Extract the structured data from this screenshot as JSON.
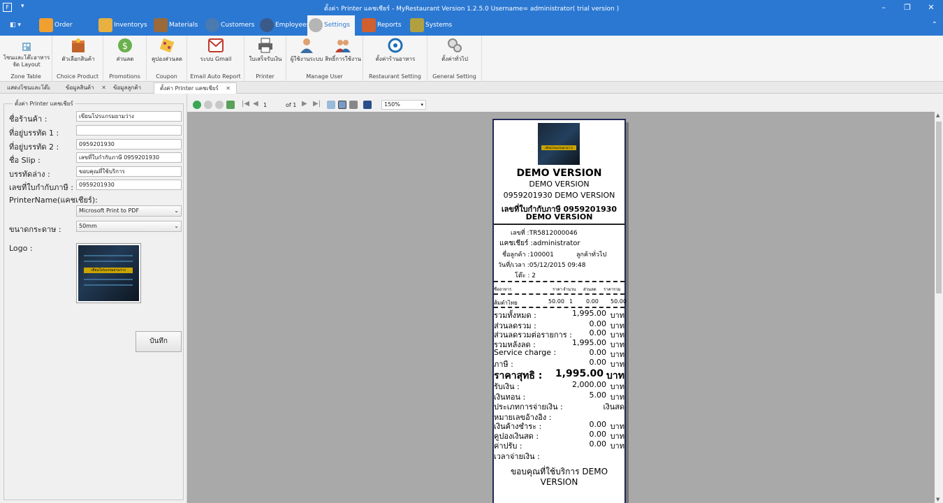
{
  "titlebar": {
    "title": "ตั้งค่า Printer แคชเชียร์ - MyRestaurant Version 1.2.5.0 Username= administrator( trial version )",
    "app_icon": "F",
    "quick_access": "▾",
    "minimize": "–",
    "restore": "❐",
    "close": "✕"
  },
  "menu": {
    "tabs": [
      {
        "label": "Order Foods",
        "icon": "checklist-icon",
        "color": "#f0a030"
      },
      {
        "label": "Inventorys",
        "icon": "box-icon",
        "color": "#e8b040"
      },
      {
        "label": "Materials",
        "icon": "books-icon",
        "color": "#9a6a3a"
      },
      {
        "label": "Customers",
        "icon": "user-icon",
        "color": "#4a7ab0"
      },
      {
        "label": "Employees",
        "icon": "employee-icon",
        "color": "#3a5a8a"
      },
      {
        "label": "Settings",
        "icon": "gears-icon",
        "color": "#909090"
      },
      {
        "label": "Reports",
        "icon": "report-icon",
        "color": "#d06030"
      },
      {
        "label": "Systems",
        "icon": "lock-icon",
        "color": "#b0a040"
      }
    ],
    "collapse": "⌃"
  },
  "ribbon": {
    "groups": [
      {
        "label": "Zone Table",
        "buttons": [
          {
            "label": "โซนและโต๊ะอาหาร จัด Layout"
          }
        ]
      },
      {
        "label": "Choice Product",
        "buttons": [
          {
            "label": "ตัวเลือกสินค้า"
          }
        ]
      },
      {
        "label": "Promotions",
        "buttons": [
          {
            "label": "ส่วนลด"
          }
        ]
      },
      {
        "label": "Coupon",
        "buttons": [
          {
            "label": "คูปองส่วนลด"
          }
        ]
      },
      {
        "label": "Email Auto Report",
        "buttons": [
          {
            "label": "ระบบ Gmail"
          }
        ]
      },
      {
        "label": "Printer",
        "buttons": [
          {
            "label": "ใบเสร็จรับเงิน"
          }
        ]
      },
      {
        "label": "Manage User",
        "buttons": [
          {
            "label": "ผู้ใช้งานระบบ"
          },
          {
            "label": "สิทธิ์การใช้งาน"
          }
        ]
      },
      {
        "label": "Restaurant Setting",
        "buttons": [
          {
            "label": "ตั้งค่าร้านอาหาร"
          }
        ]
      },
      {
        "label": "General Setting",
        "buttons": [
          {
            "label": "ตั้งค่าทั่วไป"
          }
        ]
      }
    ]
  },
  "doctabs": [
    {
      "label": "แสดงโซนและโต๊ะ",
      "closable": false
    },
    {
      "label": "ข้อมูลสินค้า",
      "closable": true
    },
    {
      "label": "ข้อมูลลูกค้า",
      "closable": false
    },
    {
      "label": "ตั้งค่า Printer แคชเชียร์",
      "closable": true
    }
  ],
  "tab_close": "✕",
  "form": {
    "group_title": "ตั้งค่า Printer แคชเชียร์",
    "shop_name_label": "ชื่อร้านค้า :",
    "shop_name": "เขียนโปรแกรมยามว่าง",
    "address1_label": "ที่อยู่บรรทัด 1 :",
    "address1": "",
    "address2_label": "ที่อยู่บรรทัด 2 :",
    "address2": "0959201930",
    "slip_label": "ชื่อ Slip :",
    "slip": "เลขที่ใบกำกับภาษี 0959201930",
    "bottom_label": "บรรทัดล่าง :",
    "bottom": "ขอบคุณที่ใช้บริการ",
    "tax_label": "เลขที่ใบกำกับภาษี :",
    "tax": "0959201930",
    "printer_label": "PrinterName(แคชเชียร์):",
    "printer": "Microsoft Print to PDF",
    "paper_label": "ขนาดกระดาษ :",
    "paper": "50mm",
    "logo_label": "Logo :",
    "logo_text": "เขียนโปรแกรมยามว่าง",
    "save": "บันทึก",
    "dropdown_arrow": "⌄"
  },
  "viewer": {
    "page": "1",
    "of": "of",
    "total": "1",
    "zoom": "150%",
    "zoom_arrow": "▾",
    "first": "|◀",
    "prev": "◀",
    "next": "▶",
    "last": "▶|",
    "scroll_up": "▲",
    "scroll_down": "▼"
  },
  "receipt": {
    "logo_text": "เขียนโปรแกรมยามว่าง",
    "shop_name": "DEMO VERSION",
    "address2": "DEMO VERSION",
    "address3": "0959201930 DEMO VERSION",
    "tax_line1": "เลขที่ใบกำกับภาษี 0959201930",
    "tax_line2": "DEMO VERSION",
    "bill_no": "เลขที่ :TR5812000046",
    "cashier": "แคชเชียร์ :administrator",
    "customer": "ชื่อลูกค้า :100001",
    "customer_name": "ลูกค้าทั่วไป",
    "datetime": "วันที่/เวลา :05/12/2015 09:48",
    "table": "โต๊ะ :  2",
    "col_name": "ชื่ออาหาร",
    "col_price": "ราคา",
    "col_qty": "จำนวน",
    "col_disc": "ส่วนลด",
    "col_total": "ราคารวม",
    "item_name": "ส้มตำไทย",
    "item_price": "50.00",
    "item_qty": "1",
    "item_disc": "0.00",
    "item_total": "50.00",
    "unit": "บาท",
    "rows": [
      {
        "k": "รวมทั้งหมด :",
        "v": "1,995.00"
      },
      {
        "k": "ส่วนลดรวม :",
        "v": "0.00"
      },
      {
        "k": "ส่วนลดรวมต่อรายการ :",
        "v": "0.00"
      },
      {
        "k": "รวมหลังลด :",
        "v": "1,995.00"
      },
      {
        "k": "Service charge :",
        "v": "0.00"
      },
      {
        "k": "ภาษี :",
        "v": "0.00"
      }
    ],
    "net_label": "ราคาสุทธิ :",
    "net_value": "1,995.00",
    "net_unit": "บาท",
    "received_label": "รับเงิน :",
    "received": "2,000.00",
    "change_label": "เงินทอน :",
    "change": "5.00",
    "paytype_label": "ประเภทการจ่ายเงิน :",
    "paytype": "เงินสด",
    "ref_label": "หมายเลขอ้างอิง :",
    "rows2": [
      {
        "k": "เงินค้างชำระ :",
        "v": "0.00"
      },
      {
        "k": "คูปองเงินสด :",
        "v": "0.00"
      },
      {
        "k": "ค่าปรับ :",
        "v": "0.00"
      }
    ],
    "paytime_label": "เวลาจ่ายเงิน :",
    "thanks1": "ขอบคุณที่ใช้บริการ DEMO",
    "thanks2": "VERSION"
  }
}
